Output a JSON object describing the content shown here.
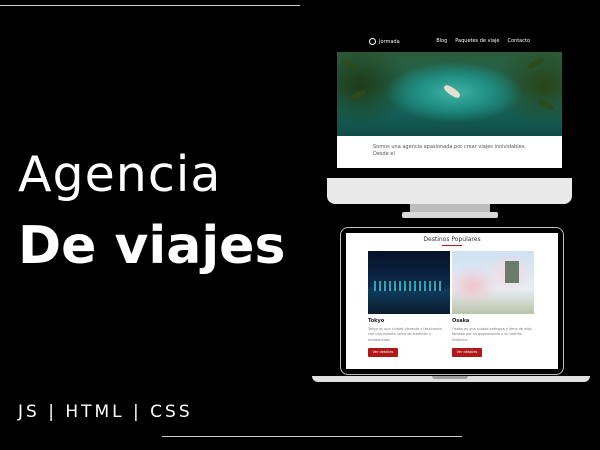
{
  "headline": {
    "line1": "Agencia",
    "line2": "De viajes"
  },
  "tech": "JS | HTML | CSS",
  "desktop": {
    "brand": "Jormada",
    "nav": [
      "Blog",
      "Paquetes de viaje",
      "Contacto"
    ],
    "about_text": "Somos una agencia apasionada por crear viajes inolvidables. Desde el"
  },
  "laptop": {
    "section_title": "Destinos Populares",
    "cards": [
      {
        "name": "Tokyo",
        "desc": "Tokyo es una ciudad vibrante y fascinante, con una mezcla única de tradición y modernidad.",
        "button": "Ver detalles"
      },
      {
        "name": "Osaka",
        "desc": "Osaka es una ciudad enérgica y llena de vida, famosa por su gastronomía y su castillo histórico.",
        "button": "Ver detalles"
      }
    ]
  },
  "colors": {
    "background": "#000000",
    "accent": "#b01818"
  }
}
